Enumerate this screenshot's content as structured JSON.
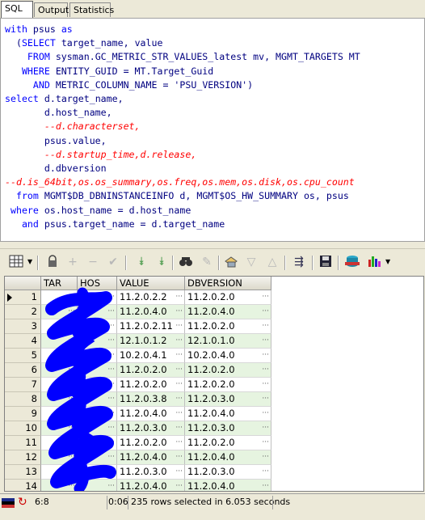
{
  "tabs": [
    {
      "label": "SQL",
      "active": true
    },
    {
      "label": "Output",
      "active": false
    },
    {
      "label": "Statistics",
      "active": false
    }
  ],
  "sql_lines": [
    [
      {
        "t": "with ",
        "c": "kw"
      },
      {
        "t": "psus ",
        "c": "id"
      },
      {
        "t": "as",
        "c": "kw"
      }
    ],
    [
      {
        "t": "  (",
        "c": "id"
      },
      {
        "t": "SELECT ",
        "c": "kw"
      },
      {
        "t": "target_name, value",
        "c": "id"
      }
    ],
    [
      {
        "t": "    FROM ",
        "c": "kw"
      },
      {
        "t": "sysman.GC_METRIC_STR_VALUES_latest mv, MGMT_TARGETS MT",
        "c": "id"
      }
    ],
    [
      {
        "t": "   WHERE ",
        "c": "kw"
      },
      {
        "t": "ENTITY_GUID = MT.Target_Guid",
        "c": "id"
      }
    ],
    [
      {
        "t": "     AND ",
        "c": "kw"
      },
      {
        "t": "METRIC_COLUMN_NAME = ",
        "c": "id"
      },
      {
        "t": "'PSU_VERSION'",
        "c": "st"
      },
      {
        "t": ")",
        "c": "id"
      }
    ],
    [
      {
        "t": "select ",
        "c": "kw"
      },
      {
        "t": "d.target_name,",
        "c": "id"
      }
    ],
    [
      {
        "t": "       d.host_name,",
        "c": "id"
      }
    ],
    [
      {
        "t": "       --d.characterset,",
        "c": "cm"
      }
    ],
    [
      {
        "t": "       psus.value,",
        "c": "id"
      }
    ],
    [
      {
        "t": "       --d.startup_time,d.release,",
        "c": "cm"
      }
    ],
    [
      {
        "t": "       d.dbversion",
        "c": "id"
      }
    ],
    [
      {
        "t": "--d.is_64bit,os.os_summary,os.freq,os.mem,os.disk,os.cpu_count",
        "c": "cm"
      }
    ],
    [
      {
        "t": "  from ",
        "c": "kw"
      },
      {
        "t": "MGMT$DB_DBNINSTANCEINFO d, MGMT$OS_HW_SUMMARY os, psus",
        "c": "id"
      }
    ],
    [
      {
        "t": " where ",
        "c": "kw"
      },
      {
        "t": "os.host_name = d.host_name",
        "c": "id"
      }
    ],
    [
      {
        "t": "   and ",
        "c": "kw"
      },
      {
        "t": "psus.target_name = d.target_name",
        "c": "id"
      }
    ]
  ],
  "columns": [
    "TAR",
    "HOS",
    "VALUE",
    "DBVERSION"
  ],
  "rows": [
    {
      "n": "1",
      "value": "11.2.0.2.2",
      "dbversion": "11.2.0.2.0"
    },
    {
      "n": "2",
      "value": "11.2.0.4.0",
      "dbversion": "11.2.0.4.0"
    },
    {
      "n": "3",
      "value": "11.2.0.2.11",
      "dbversion": "11.2.0.2.0"
    },
    {
      "n": "4",
      "value": "12.1.0.1.2",
      "dbversion": "12.1.0.1.0"
    },
    {
      "n": "5",
      "value": "10.2.0.4.1",
      "dbversion": "10.2.0.4.0"
    },
    {
      "n": "6",
      "value": "11.2.0.2.0",
      "dbversion": "11.2.0.2.0"
    },
    {
      "n": "7",
      "value": "11.2.0.2.0",
      "dbversion": "11.2.0.2.0"
    },
    {
      "n": "8",
      "value": "11.2.0.3.8",
      "dbversion": "11.2.0.3.0"
    },
    {
      "n": "9",
      "value": "11.2.0.4.0",
      "dbversion": "11.2.0.4.0"
    },
    {
      "n": "10",
      "value": "11.2.0.3.0",
      "dbversion": "11.2.0.3.0"
    },
    {
      "n": "11",
      "value": "11.2.0.2.0",
      "dbversion": "11.2.0.2.0"
    },
    {
      "n": "12",
      "value": "11.2.0.4.0",
      "dbversion": "11.2.0.4.0"
    },
    {
      "n": "13",
      "value": "11.2.0.3.0",
      "dbversion": "11.2.0.3.0"
    },
    {
      "n": "14",
      "value": "11.2.0.4.0",
      "dbversion": "11.2.0.4.0"
    }
  ],
  "toolbar_icons": [
    "grid-layout-icon",
    "lock-icon",
    "add-record-icon",
    "delete-record-icon",
    "post-edit-icon",
    "next-page-icon",
    "last-page-icon",
    "find-icon",
    "clear-icon",
    "export-icon",
    "filter-down-icon",
    "filter-up-icon",
    "flow-icon",
    "save-icon",
    "database-icon",
    "chart-icon"
  ],
  "status": {
    "position": "6:8",
    "elapsed": "0:06",
    "message": "235 rows selected in 6.053 seconds"
  },
  "colors": {
    "keyword": "#0000ff",
    "identifier": "#000080",
    "comment": "#ff0000",
    "row_alt": "#e6f4e0",
    "redaction": "#0000ff"
  }
}
